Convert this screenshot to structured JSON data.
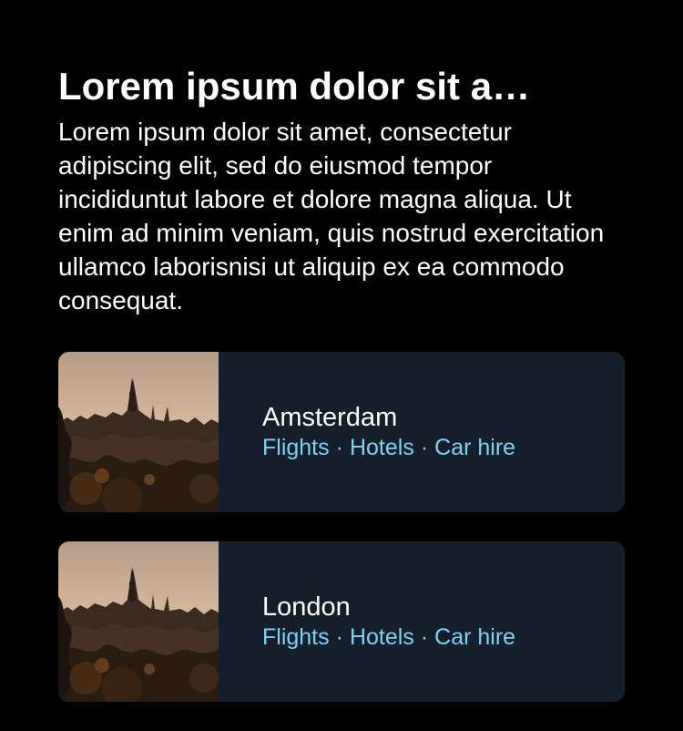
{
  "header": {
    "title": "Lorem ipsum dolor sit a…",
    "description": "Lorem ipsum dolor sit amet, consectetur adipiscing elit, sed do eiusmod tempor incididuntut labore et dolore magna aliqua. Ut enim ad minim veniam, quis nostrud exercitation ullamco laborisnisi ut aliquip ex ea commodo consequat."
  },
  "colors": {
    "background": "#000000",
    "card_background": "#151e2b",
    "link": "#7ed1f5",
    "text": "#ffffff"
  },
  "cards": [
    {
      "image": "city-skyline-photo",
      "city": "Amsterdam",
      "links": {
        "flights": "Flights",
        "hotels": "Hotels",
        "car_hire": "Car hire"
      },
      "separator": "·"
    },
    {
      "image": "city-skyline-photo",
      "city": "London",
      "links": {
        "flights": "Flights",
        "hotels": "Hotels",
        "car_hire": "Car hire"
      },
      "separator": "·"
    }
  ]
}
